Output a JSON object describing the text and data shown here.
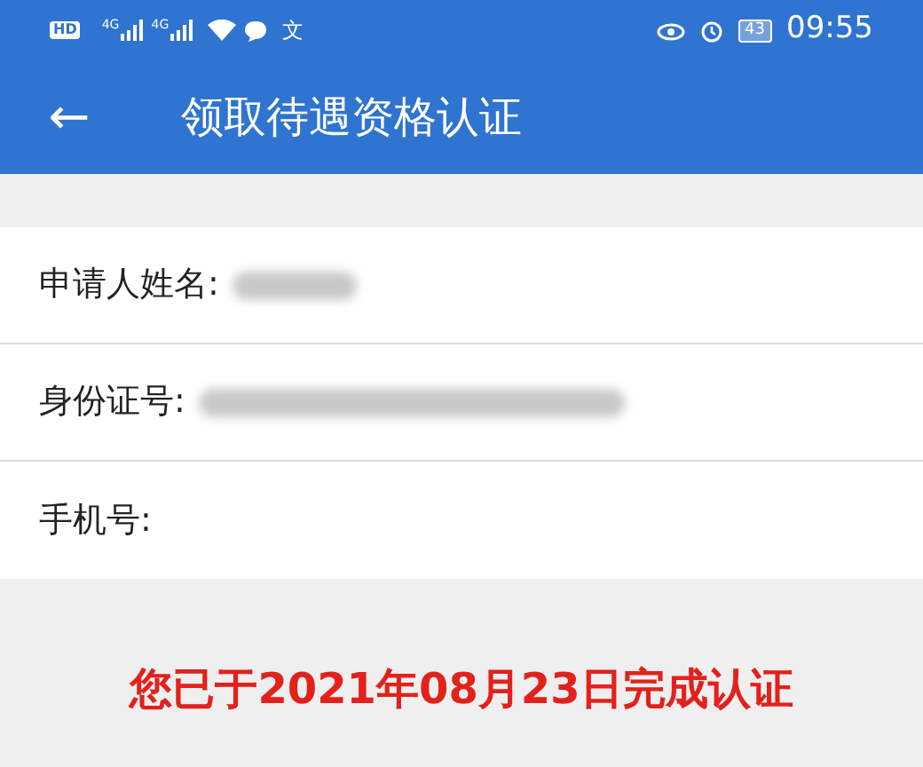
{
  "status_bar": {
    "hd_label": "HD",
    "network_labels": [
      "4G",
      "4G"
    ],
    "notification_glyph": "文",
    "battery": "43",
    "time": "09:55"
  },
  "app_bar": {
    "back_icon": "←",
    "title": "领取待遇资格认证"
  },
  "fields": [
    {
      "label": "申请人姓名:",
      "kind": "name"
    },
    {
      "label": "身份证号:",
      "kind": "id"
    },
    {
      "label": "手机号:"
    }
  ],
  "status_message": "您已于2021年08月23日完成认证"
}
